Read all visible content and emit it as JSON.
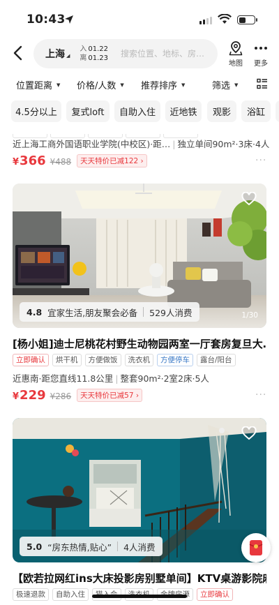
{
  "status": {
    "time": "10:43"
  },
  "header": {
    "city": "上海",
    "checkin_label": "入",
    "checkin_date": "01.22",
    "checkout_label": "离",
    "checkout_date": "01.23",
    "search_placeholder": "搜索位置、地标、房…",
    "map_label": "地图",
    "more_label": "更多"
  },
  "filters": [
    {
      "label": "位置距离"
    },
    {
      "label": "价格/人数"
    },
    {
      "label": "推荐排序"
    },
    {
      "label": "筛选"
    }
  ],
  "chips": [
    "4.5分以上",
    "复式loft",
    "自助入住",
    "近地铁",
    "观影",
    "浴缸"
  ],
  "listings": [
    {
      "meta_location": "近上海工商外国语职业学院(中校区)·距…",
      "meta_room": "独立单间90m²·3床·4人",
      "price_currency": "¥",
      "price": "366",
      "old_price": "¥488",
      "promo": "天天特价已减122"
    },
    {
      "rating": "4.8",
      "review_quote": "宜家生活,朋友聚会必备",
      "consumers": "529人消费",
      "photo_count": "1/30",
      "title": "[杨小姐]迪士尼桃花村野生动物园两室一厅套房复旦大…",
      "tags": [
        {
          "label": "立即确认",
          "style": "red"
        },
        {
          "label": "烘干机",
          "style": "plain"
        },
        {
          "label": "方便做饭",
          "style": "plain"
        },
        {
          "label": "洗衣机",
          "style": "plain"
        },
        {
          "label": "方便停车",
          "style": "blue"
        },
        {
          "label": "露台/阳台",
          "style": "plain"
        }
      ],
      "meta_location": "近惠南·距您直线11.8公里",
      "meta_room": "整套90m²·2室2床·5人",
      "price_currency": "¥",
      "price": "229",
      "old_price": "¥286",
      "promo": "天天特价已减57"
    },
    {
      "rating": "5.0",
      "review_quote": "“房东热情,贴心”",
      "consumers": "4人消费",
      "title": "【欧若拉网红ins大床投影房别墅单间】KTV桌游影院麻…",
      "tags": [
        {
          "label": "极速退款",
          "style": "plain"
        },
        {
          "label": "自助入住",
          "style": "plain"
        },
        {
          "label": "猫入会",
          "style": "plain"
        },
        {
          "label": "洗衣机",
          "style": "plain"
        },
        {
          "label": "金牌房源",
          "style": "plain"
        },
        {
          "label": "立即确认",
          "style": "red"
        }
      ]
    }
  ],
  "colors": {
    "accent_red": "#e8383d",
    "tag_blue": "#3a79c7"
  },
  "icons": [
    "location-arrow-icon",
    "back-arrow-icon",
    "map-pin-icon",
    "more-dots-icon",
    "list-view-icon",
    "heart-icon",
    "red-packet-icon"
  ]
}
